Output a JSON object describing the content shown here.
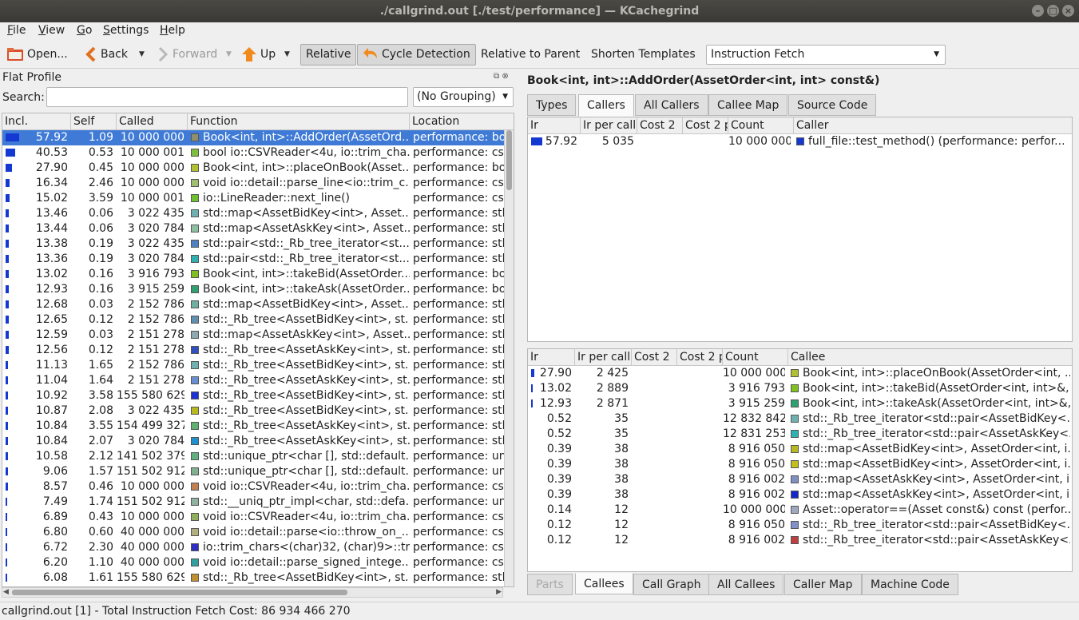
{
  "window": {
    "title": "./callgrind.out [./test/performance] — KCachegrind",
    "buttons": [
      "minimize",
      "maximize",
      "close"
    ]
  },
  "menubar": [
    "File",
    "View",
    "Go",
    "Settings",
    "Help"
  ],
  "toolbar": {
    "open_label": "Open...",
    "back_label": "Back",
    "forward_label": "Forward",
    "up_label": "Up",
    "relative_label": "Relative",
    "cycle_detection_label": "Cycle Detection",
    "relative_to_parent_label": "Relative to Parent",
    "shorten_templates_label": "Shorten Templates",
    "event_type": "Instruction Fetch"
  },
  "flat_profile": {
    "title": "Flat Profile",
    "search_label": "Search:",
    "search_value": "",
    "grouping": "(No Grouping)",
    "columns": [
      "Incl.",
      "Self",
      "Called",
      "Function",
      "Location"
    ],
    "rows": [
      {
        "incl": "57.92",
        "self": "1.09",
        "called": "10 000 000",
        "color": "#8f8f6e",
        "func": "Book<int, int>::AddOrder(AssetOrd...",
        "loc": "performance: boo",
        "selected": true
      },
      {
        "incl": "40.53",
        "self": "0.53",
        "called": "10 000 001",
        "color": "#7fbf3f",
        "func": "bool io::CSVReader<4u, io::trim_cha...",
        "loc": "performance: csv"
      },
      {
        "incl": "27.90",
        "self": "0.45",
        "called": "10 000 000",
        "color": "#b0c030",
        "func": "Book<int, int>::placeOnBook(Asset...",
        "loc": "performance: boo"
      },
      {
        "incl": "16.34",
        "self": "2.46",
        "called": "10 000 000",
        "color": "#9fbf6f",
        "func": "void io::detail::parse_line<io::trim_c...",
        "loc": "performance: csv"
      },
      {
        "incl": "15.02",
        "self": "3.59",
        "called": "10 000 001",
        "color": "#6fbf2f",
        "func": "io::LineReader::next_line()",
        "loc": "performance: csv"
      },
      {
        "incl": "13.46",
        "self": "0.06",
        "called": "3 022 435",
        "color": "#6fb0b0",
        "func": "std::map<AssetBidKey<int>, Asset...",
        "loc": "performance: stl_"
      },
      {
        "incl": "13.44",
        "self": "0.06",
        "called": "3 020 784",
        "color": "#8fbfa0",
        "func": "std::map<AssetAskKey<int>, Asset...",
        "loc": "performance: stl_"
      },
      {
        "incl": "13.38",
        "self": "0.19",
        "called": "3 022 435",
        "color": "#5080c0",
        "func": "std::pair<std::_Rb_tree_iterator<st...",
        "loc": "performance: stl_"
      },
      {
        "incl": "13.36",
        "self": "0.19",
        "called": "3 020 784",
        "color": "#30b0b0",
        "func": "std::pair<std::_Rb_tree_iterator<st...",
        "loc": "performance: stl_"
      },
      {
        "incl": "13.02",
        "self": "0.16",
        "called": "3 916 793",
        "color": "#80c020",
        "func": "Book<int, int>::takeBid(AssetOrder...",
        "loc": "performance: boo"
      },
      {
        "incl": "12.93",
        "self": "0.16",
        "called": "3 915 259",
        "color": "#30a070",
        "func": "Book<int, int>::takeAsk(AssetOrder...",
        "loc": "performance: boo"
      },
      {
        "incl": "12.68",
        "self": "0.03",
        "called": "2 152 786",
        "color": "#70b0a0",
        "func": "std::map<AssetBidKey<int>, Asset...",
        "loc": "performance: stl_"
      },
      {
        "incl": "12.65",
        "self": "0.12",
        "called": "2 152 786",
        "color": "#6090b0",
        "func": "std::_Rb_tree<AssetBidKey<int>, st...",
        "loc": "performance: stl_"
      },
      {
        "incl": "12.59",
        "self": "0.03",
        "called": "2 151 278",
        "color": "#90a8b0",
        "func": "std::map<AssetAskKey<int>, Asset...",
        "loc": "performance: stl_"
      },
      {
        "incl": "12.56",
        "self": "0.12",
        "called": "2 151 278",
        "color": "#3050c0",
        "func": "std::_Rb_tree<AssetAskKey<int>, st...",
        "loc": "performance: stl_"
      },
      {
        "incl": "11.13",
        "self": "1.65",
        "called": "2 152 786",
        "color": "#70b0b0",
        "func": "std::_Rb_tree<AssetBidKey<int>, st...",
        "loc": "performance: stl_"
      },
      {
        "incl": "11.04",
        "self": "1.64",
        "called": "2 151 278",
        "color": "#6a8fd0",
        "func": "std::_Rb_tree<AssetAskKey<int>, st...",
        "loc": "performance: stl_"
      },
      {
        "incl": "10.92",
        "self": "3.58",
        "called": "155 580 629",
        "color": "#2030d0",
        "func": "std::_Rb_tree<AssetBidKey<int>, st...",
        "loc": "performance: stl_"
      },
      {
        "incl": "10.87",
        "self": "2.08",
        "called": "3 022 435",
        "color": "#b8b820",
        "func": "std::_Rb_tree<AssetBidKey<int>, st...",
        "loc": "performance: stl_"
      },
      {
        "incl": "10.84",
        "self": "3.55",
        "called": "154 499 327",
        "color": "#60b070",
        "func": "std::_Rb_tree<AssetAskKey<int>, st...",
        "loc": "performance: stl_"
      },
      {
        "incl": "10.84",
        "self": "2.07",
        "called": "3 020 784",
        "color": "#2090d0",
        "func": "std::_Rb_tree<AssetAskKey<int>, st...",
        "loc": "performance: stl_"
      },
      {
        "incl": "10.58",
        "self": "2.12",
        "called": "141 502 379",
        "color": "#60b080",
        "func": "std::unique_ptr<char [], std::default...",
        "loc": "performance: uni"
      },
      {
        "incl": "9.06",
        "self": "1.57",
        "called": "151 502 912",
        "color": "#80b090",
        "func": "std::unique_ptr<char [], std::default...",
        "loc": "performance: uni"
      },
      {
        "incl": "8.57",
        "self": "0.46",
        "called": "10 000 000",
        "color": "#c08050",
        "func": "void io::CSVReader<4u, io::trim_cha...",
        "loc": "performance: csv"
      },
      {
        "incl": "7.49",
        "self": "1.74",
        "called": "151 502 912",
        "color": "#90b0a0",
        "func": "std::__uniq_ptr_impl<char, std::defa...",
        "loc": "performance: uni"
      },
      {
        "incl": "6.89",
        "self": "0.43",
        "called": "10 000 000",
        "color": "#90b060",
        "func": "void io::CSVReader<4u, io::trim_cha...",
        "loc": "performance: csv"
      },
      {
        "incl": "6.80",
        "self": "0.60",
        "called": "40 000 000",
        "color": "#b0b080",
        "func": "void io::detail::parse<io::throw_on_...",
        "loc": "performance: csv"
      },
      {
        "incl": "6.72",
        "self": "2.30",
        "called": "40 000 000",
        "color": "#3030c0",
        "func": "io::trim_chars<(char)32, (char)9>::tri...",
        "loc": "performance: csv"
      },
      {
        "incl": "6.20",
        "self": "1.10",
        "called": "40 000 000",
        "color": "#30a0a0",
        "func": "void io::detail::parse_signed_intege...",
        "loc": "performance: csv"
      },
      {
        "incl": "6.08",
        "self": "1.61",
        "called": "155 580 629",
        "color": "#c09030",
        "func": "std::_Rb_tree<AssetBidKey<int>, st...",
        "loc": "performance: stl_"
      }
    ]
  },
  "detail": {
    "function_title": "Book<int, int>::AddOrder(AssetOrder<int, int> const&)",
    "top_tabs": [
      "Types",
      "Callers",
      "All Callers",
      "Callee Map",
      "Source Code"
    ],
    "top_active": 1,
    "callers_columns": [
      "Ir",
      "Ir per call",
      "Cost 2",
      "Cost 2 p",
      "Count",
      "Caller"
    ],
    "callers": [
      {
        "ir": "57.92",
        "per_call": "5 035",
        "cost2": "",
        "cost2p": "",
        "count": "10 000 000",
        "color": "#1438d2",
        "name": "full_file::test_method() (performance: perfor..."
      }
    ],
    "callees_columns": [
      "Ir",
      "Ir per call",
      "Cost 2",
      "Cost 2 p",
      "Count",
      "Callee"
    ],
    "callees": [
      {
        "ir": "27.90",
        "per_call": "2 425",
        "count": "10 000 000",
        "color": "#b0c030",
        "name": "Book<int, int>::placeOnBook(AssetOrder<int, ..."
      },
      {
        "ir": "13.02",
        "per_call": "2 889",
        "count": "3 916 793",
        "color": "#80c020",
        "name": "Book<int, int>::takeBid(AssetOrder<int, int>&,..."
      },
      {
        "ir": "12.93",
        "per_call": "2 871",
        "count": "3 915 259",
        "color": "#30a070",
        "name": "Book<int, int>::takeAsk(AssetOrder<int, int>&,..."
      },
      {
        "ir": "0.52",
        "per_call": "35",
        "count": "12 832 842",
        "color": "#70b0b0",
        "name": "std::_Rb_tree_iterator<std::pair<AssetBidKey<..."
      },
      {
        "ir": "0.52",
        "per_call": "35",
        "count": "12 831 253",
        "color": "#30b0b0",
        "name": "std::_Rb_tree_iterator<std::pair<AssetAskKey<..."
      },
      {
        "ir": "0.39",
        "per_call": "38",
        "count": "8 916 050",
        "color": "#b8b820",
        "name": "std::map<AssetBidKey<int>, AssetOrder<int, i..."
      },
      {
        "ir": "0.39",
        "per_call": "38",
        "count": "8 916 050",
        "color": "#c0c020",
        "name": "std::map<AssetBidKey<int>, AssetOrder<int, i..."
      },
      {
        "ir": "0.39",
        "per_call": "38",
        "count": "8 916 002",
        "color": "#8090c0",
        "name": "std::map<AssetAskKey<int>, AssetOrder<int, i..."
      },
      {
        "ir": "0.39",
        "per_call": "38",
        "count": "8 916 002",
        "color": "#1428c8",
        "name": "std::map<AssetAskKey<int>, AssetOrder<int, i..."
      },
      {
        "ir": "0.14",
        "per_call": "12",
        "count": "10 000 000",
        "color": "#a0a8c0",
        "name": "Asset::operator==(Asset const&) const (perfor..."
      },
      {
        "ir": "0.12",
        "per_call": "12",
        "count": "8 916 050",
        "color": "#8090c8",
        "name": "std::_Rb_tree_iterator<std::pair<AssetBidKey<..."
      },
      {
        "ir": "0.12",
        "per_call": "12",
        "count": "8 916 002",
        "color": "#c04040",
        "name": "std::_Rb_tree_iterator<std::pair<AssetAskKey<..."
      }
    ],
    "bottom_tabs": [
      "Parts",
      "Callees",
      "Call Graph",
      "All Callees",
      "Caller Map",
      "Machine Code"
    ],
    "bottom_active": 1
  },
  "status": "callgrind.out [1] - Total Instruction Fetch Cost: 86 934 466 270"
}
